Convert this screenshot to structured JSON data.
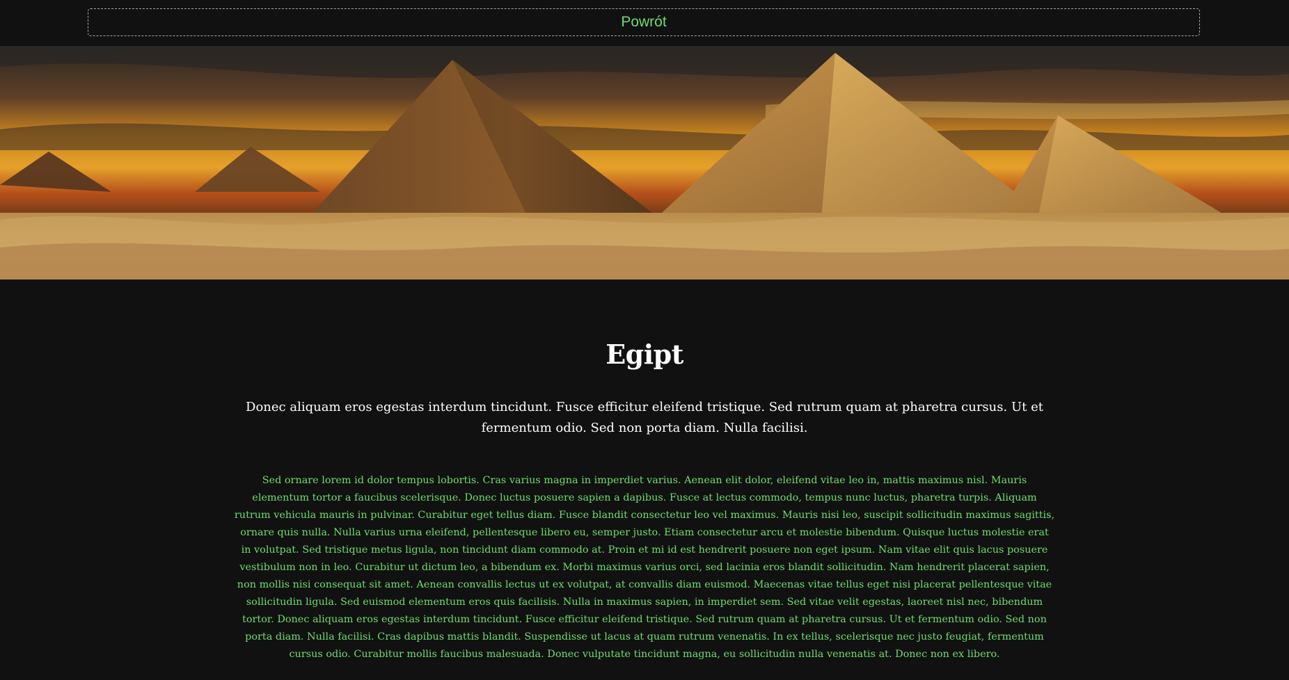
{
  "header": {
    "back_label": "Powrót"
  },
  "hero": {
    "icon": "pyramids-image"
  },
  "article": {
    "title": "Egipt",
    "lead": "Donec aliquam eros egestas interdum tincidunt. Fusce efficitur eleifend tristique. Sed rutrum quam at pharetra cursus. Ut et fermentum odio. Sed non porta diam. Nulla facilisi.",
    "body": "Sed ornare lorem id dolor tempus lobortis. Cras varius magna in imperdiet varius. Aenean elit dolor, eleifend vitae leo in, mattis maximus nisl. Mauris elementum tortor a faucibus scelerisque. Donec luctus posuere sapien a dapibus. Fusce at lectus commodo, tempus nunc luctus, pharetra turpis. Aliquam rutrum vehicula mauris in pulvinar. Curabitur eget tellus diam. Fusce blandit consectetur leo vel maximus. Mauris nisi leo, suscipit sollicitudin maximus sagittis, ornare quis nulla. Nulla varius urna eleifend, pellentesque libero eu, semper justo. Etiam consectetur arcu et molestie bibendum. Quisque luctus molestie erat in volutpat. Sed tristique metus ligula, non tincidunt diam commodo at. Proin et mi id est hendrerit posuere non eget ipsum. Nam vitae elit quis lacus posuere vestibulum non in leo. Curabitur ut dictum leo, a bibendum ex. Morbi maximus varius orci, sed lacinia eros blandit sollicitudin. Nam hendrerit placerat sapien, non mollis nisi consequat sit amet. Aenean convallis lectus ut ex volutpat, at convallis diam euismod. Maecenas vitae tellus eget nisi placerat pellentesque vitae sollicitudin ligula. Sed euismod elementum eros quis facilisis. Nulla in maximus sapien, in imperdiet sem. Sed vitae velit egestas, laoreet nisl nec, bibendum tortor. Donec aliquam eros egestas interdum tincidunt. Fusce efficitur eleifend tristique. Sed rutrum quam at pharetra cursus. Ut et fermentum odio. Sed non porta diam. Nulla facilisi. Cras dapibus mattis blandit. Suspendisse ut lacus at quam rutrum venenatis. In ex tellus, scelerisque nec justo feugiat, fermentum cursus odio. Curabitur mollis faucibus malesuada. Donec vulputate tincidunt magna, eu sollicitudin nulla venenatis at. Donec non ex libero."
  },
  "colors": {
    "background": "#111111",
    "accent_green": "#6fdc6f",
    "heading": "#ffffff",
    "button_border": "#a8a8a8"
  }
}
